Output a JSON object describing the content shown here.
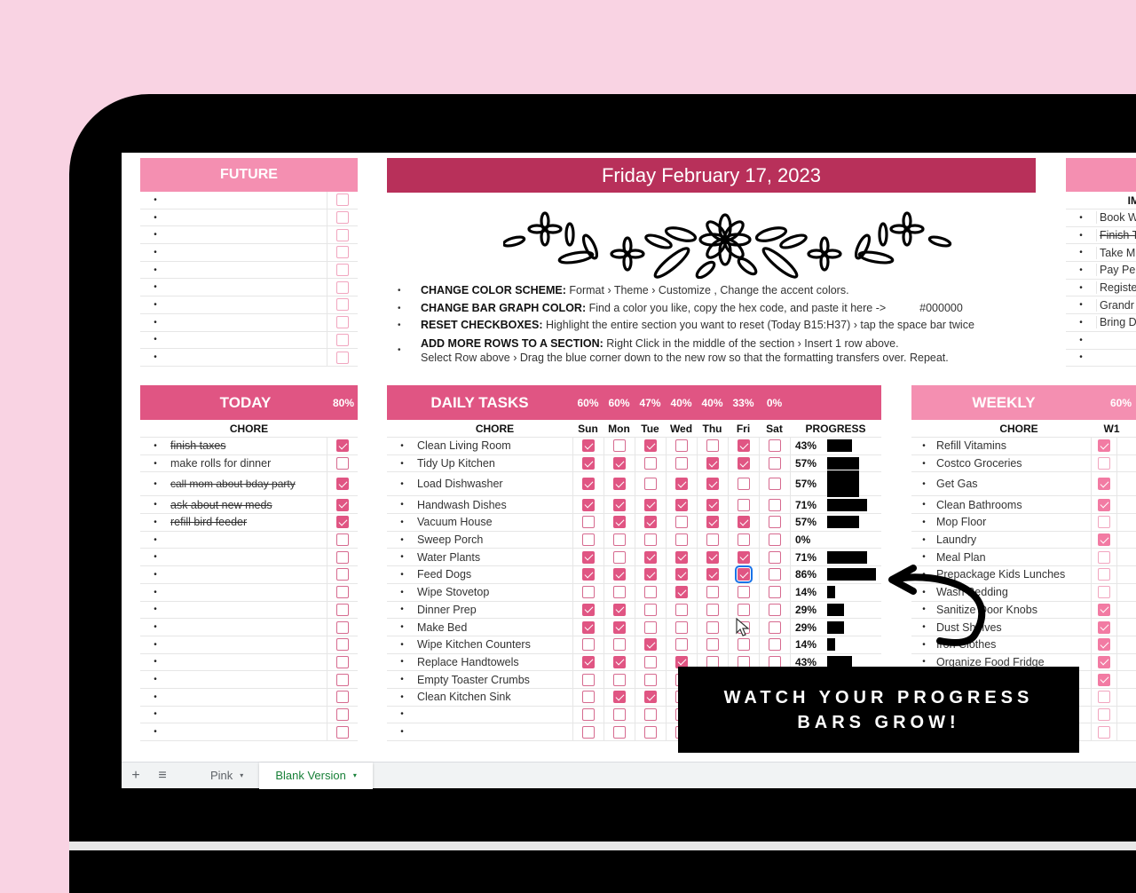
{
  "date_title": "Friday February 17, 2023",
  "future": {
    "title": "FUTURE",
    "rows": 10
  },
  "important": {
    "header": "IMPO",
    "items": [
      {
        "text": "Book W",
        "done": false
      },
      {
        "text": "Finish T",
        "done": true
      },
      {
        "text": "Take M",
        "done": false
      },
      {
        "text": "Pay Pe",
        "done": false
      },
      {
        "text": "Registe",
        "done": false
      },
      {
        "text": "Grandr",
        "done": false
      },
      {
        "text": "Bring D",
        "done": false
      },
      {
        "text": "",
        "done": false
      },
      {
        "text": "",
        "done": false
      }
    ]
  },
  "instructions": [
    {
      "label": "CHANGE COLOR SCHEME:",
      "text": " Format › Theme › Customize , Change the accent colors."
    },
    {
      "label": "CHANGE BAR GRAPH COLOR:",
      "text": " Find a color you like, copy the hex code, and paste it here ->",
      "value": "#000000"
    },
    {
      "label": "RESET CHECKBOXES:",
      "text": " Highlight the entire section you want to reset (Today B15:H37) › tap the space bar twice"
    },
    {
      "label": "ADD MORE ROWS TO A SECTION:",
      "text": " Right Click in the middle of the section › Insert 1 row above.",
      "text2": "Select Row above › Drag the blue corner down to the new row so that the formatting transfers over. Repeat."
    }
  ],
  "today": {
    "title": "TODAY",
    "percent": "80%",
    "col_header": "CHORE",
    "items": [
      {
        "text": "finish taxes",
        "done": true,
        "tall": false
      },
      {
        "text": "make rolls for dinner",
        "done": false,
        "tall": false
      },
      {
        "text": "call mom about bday party",
        "done": true,
        "tall": true
      },
      {
        "text": "ask about new meds",
        "done": true,
        "tall": false
      },
      {
        "text": "refill bird feeder",
        "done": true,
        "tall": false
      },
      {
        "text": "",
        "done": false
      },
      {
        "text": "",
        "done": false
      },
      {
        "text": "",
        "done": false
      },
      {
        "text": "",
        "done": false
      },
      {
        "text": "",
        "done": false
      },
      {
        "text": "",
        "done": false
      },
      {
        "text": "",
        "done": false
      },
      {
        "text": "",
        "done": false
      },
      {
        "text": "",
        "done": false
      },
      {
        "text": "",
        "done": false
      },
      {
        "text": "",
        "done": false
      },
      {
        "text": "",
        "done": false
      }
    ]
  },
  "daily": {
    "title": "DAILY TASKS",
    "day_percents": [
      "60%",
      "60%",
      "47%",
      "40%",
      "40%",
      "33%",
      "0%"
    ],
    "col_header": "CHORE",
    "days": [
      "Sun",
      "Mon",
      "Tue",
      "Wed",
      "Thu",
      "Fri",
      "Sat"
    ],
    "progress_header": "PROGRESS",
    "tasks": [
      {
        "name": "Clean Living Room",
        "checks": [
          1,
          0,
          1,
          0,
          0,
          1,
          0
        ],
        "percent": "43%",
        "progress": 0.43
      },
      {
        "name": "Tidy Up Kitchen",
        "checks": [
          1,
          1,
          0,
          0,
          1,
          1,
          0
        ],
        "percent": "57%",
        "progress": 0.57
      },
      {
        "name": "Load Dishwasher",
        "checks": [
          1,
          1,
          0,
          1,
          1,
          0,
          0
        ],
        "percent": "57%",
        "progress": 0.57,
        "tall": true
      },
      {
        "name": "Handwash Dishes",
        "checks": [
          1,
          1,
          1,
          1,
          1,
          0,
          0
        ],
        "percent": "71%",
        "progress": 0.71
      },
      {
        "name": "Vacuum House",
        "checks": [
          0,
          1,
          1,
          0,
          1,
          1,
          0
        ],
        "percent": "57%",
        "progress": 0.57
      },
      {
        "name": "Sweep Porch",
        "checks": [
          0,
          0,
          0,
          0,
          0,
          0,
          0
        ],
        "percent": "0%",
        "progress": 0
      },
      {
        "name": "Water Plants",
        "checks": [
          1,
          0,
          1,
          1,
          1,
          1,
          0
        ],
        "percent": "71%",
        "progress": 0.71
      },
      {
        "name": "Feed Dogs",
        "checks": [
          1,
          1,
          1,
          1,
          1,
          1,
          0
        ],
        "percent": "86%",
        "progress": 0.86,
        "selected_day": 5
      },
      {
        "name": "Wipe Stovetop",
        "checks": [
          0,
          0,
          0,
          1,
          0,
          0,
          0
        ],
        "percent": "14%",
        "progress": 0.14
      },
      {
        "name": "Dinner Prep",
        "checks": [
          1,
          1,
          0,
          0,
          0,
          0,
          0
        ],
        "percent": "29%",
        "progress": 0.29
      },
      {
        "name": "Make Bed",
        "checks": [
          1,
          1,
          0,
          0,
          0,
          0,
          0
        ],
        "percent": "29%",
        "progress": 0.29
      },
      {
        "name": "Wipe Kitchen Counters",
        "checks": [
          0,
          0,
          1,
          0,
          0,
          0,
          0
        ],
        "percent": "14%",
        "progress": 0.14
      },
      {
        "name": "Replace Handtowels",
        "checks": [
          1,
          1,
          0,
          1,
          0,
          0,
          0
        ],
        "percent": "43%",
        "progress": 0.43
      },
      {
        "name": "Empty Toaster Crumbs",
        "checks": [
          0,
          0,
          0,
          0,
          0,
          0,
          0
        ],
        "percent": "",
        "progress": 0
      },
      {
        "name": "Clean Kitchen Sink",
        "checks": [
          0,
          1,
          1,
          0,
          0,
          0,
          0
        ],
        "percent": "",
        "progress": 0
      },
      {
        "name": "",
        "checks": [
          0,
          0,
          0,
          0,
          0,
          0,
          0
        ],
        "percent": "",
        "progress": 0
      },
      {
        "name": "",
        "checks": [
          0,
          0,
          0,
          0,
          0,
          0,
          0
        ],
        "percent": "",
        "progress": 0
      }
    ]
  },
  "weekly": {
    "title": "WEEKLY",
    "percent": "60%",
    "col_header": "CHORE",
    "week_header": "W1",
    "items": [
      {
        "text": "Refill Vitamins",
        "done": true
      },
      {
        "text": "Costco Groceries",
        "done": false
      },
      {
        "text": "Get Gas",
        "done": true,
        "tall": true
      },
      {
        "text": "Clean Bathrooms",
        "done": true
      },
      {
        "text": "Mop Floor",
        "done": false
      },
      {
        "text": "Laundry",
        "done": true
      },
      {
        "text": "Meal Plan",
        "done": false
      },
      {
        "text": "Prepackage Kids Lunches",
        "done": false
      },
      {
        "text": "Wash Bedding",
        "done": false
      },
      {
        "text": "Sanitize Door Knobs",
        "done": true
      },
      {
        "text": "Dust Shelves",
        "done": true
      },
      {
        "text": "Iron Clothes",
        "done": true
      },
      {
        "text": "Organize Food Fridge",
        "done": true
      },
      {
        "text": "",
        "done": true
      },
      {
        "text": "",
        "done": false
      },
      {
        "text": "",
        "done": false
      },
      {
        "text": "",
        "done": false
      }
    ]
  },
  "banner": {
    "line1": "WATCH YOUR PROGRESS",
    "line2": "BARS GROW!"
  },
  "sheet_tabs": {
    "add_icon": "+",
    "list_icon": "≡",
    "tabs": [
      {
        "label": "Pink",
        "active": false
      },
      {
        "label": "Blank Version",
        "active": true
      }
    ],
    "dropdown_icon": "▾"
  },
  "colors": {
    "background": "#f9d3e3",
    "accent_light": "#f48fb1",
    "accent_mid": "#e05583",
    "accent_dark": "#b8305a",
    "bar_color": "#000000"
  }
}
